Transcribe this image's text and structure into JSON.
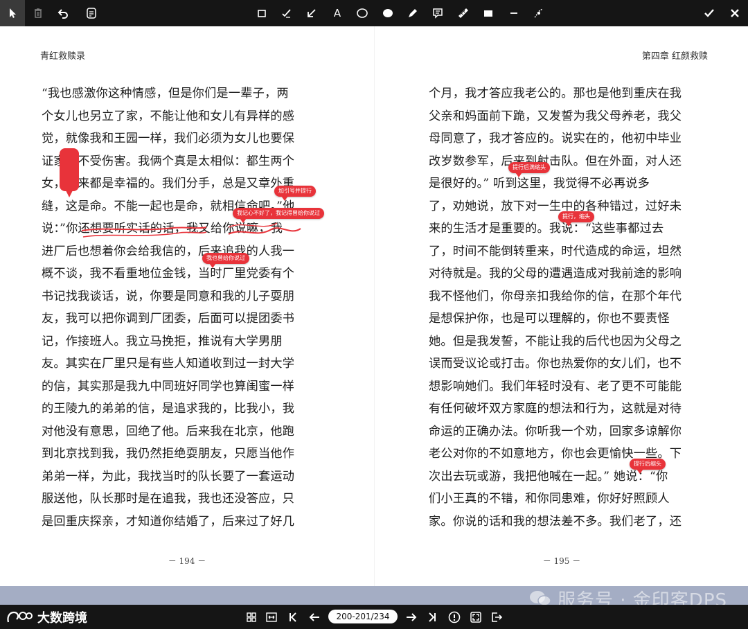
{
  "toolbar": {
    "left_tools": [
      "select-icon",
      "trash-icon",
      "undo-icon",
      "notes-icon"
    ],
    "center_tools": [
      "rectangle-icon",
      "check-pen-icon",
      "arrow-icon",
      "text-icon",
      "ellipse-icon",
      "filled-circle-icon",
      "pen-icon",
      "comment-icon",
      "ruler-icon",
      "filled-rectangle-icon",
      "line-icon",
      "node-path-icon"
    ],
    "text_tool_label": "A",
    "right_tools": [
      "confirm-icon",
      "close-icon"
    ]
  },
  "left_page": {
    "running_head": "青红救赎录",
    "lines": [
      "“我也感激你这种情感，但是你们是一辈子，两",
      "个女儿也另立了家，不能让他和女儿有异样的感",
      "觉，就像我和王园一样，我们必须为女儿也要保",
      "证家庭不受伤害。我俩个真是太相似：都生两个",
      "女，将来都是幸福的。我们分手，总是又章外重",
      "缝，这是命。不能一起也是命，就相信命吧。”他",
      "说：”你还想要听实话的话，我又给你说嘛，我",
      "进厂后也想着你会给我信的，后来追我的人我一",
      "概不谈，我不看重地位金钱，当时厂里党委有个",
      "书记找我谈话，说，你要是同意和我的儿子耍朋",
      "友，我可以把你调到厂团委，后面可以提团委书",
      "记，作接班人。我立马挽拒，推说有大学男朋",
      "友。其实在厂里只是有些人知道收到过一封大学",
      "的信，其实那是我九中同班好同学也算闺蜜一样",
      "的王陵九的弟弟的信，是追求我的，比我小，我",
      "对他没有意思，回绝了他。后来我在北京，他跑",
      "到北京找到我，我仍然拒绝耍朋友，只愿当他作",
      "弟弟一样，为此，我找当时的队长要了一套运动",
      "服送他，队长那时是在追我，我也还没答应，只",
      "是回重庆探亲，才知道你结婚了，后来过了好几"
    ],
    "page_number": "－ 194 －"
  },
  "right_page": {
    "running_head": "第四章  红颜救赎",
    "lines": [
      "个月，我才答应我老公的。那也是他到重庆在我",
      "父亲和妈面前下跪，又发誓为我父母养老，我父",
      "母同意了，我才答应的。说实在的，他初中毕业",
      "改岁数参军，后来到射击队。但在外面，对人还",
      "是很好的。” 听到这里，我觉得不必再说多",
      "了，劝她说，放下对一生中的各种错过，过好未",
      "来的生活才是重要的。我说：“这些事都过去",
      "了，时间不能倒转重来，时代造成的命运，坦然",
      "对待就是。我的父母的遭遇造成对我前途的影响",
      "我不怪他们，你母亲扣我给你的信，在那个年代",
      "是想保护你，也是可以理解的，你也不要责怪",
      "她。但是我发誓，不能让我的后代也因为父母之",
      "误而受议论或打击。你也热爱你的女儿们，也不",
      "想影响她们。我们年轻时没有、老了更不可能能",
      "有任何破坏双方家庭的想法和行为，这就是对待",
      "命运的正确办法。你听我一个劝，回家多谅解你",
      "老公对你的不如意地方，你也会更愉快一些。下",
      "次出去玩或游，我把他喊在一起。” 她说：“你",
      "们小王真的不错，和你同患难，你好好照顾人",
      "家。你说的话和我的想法差不多。我们老了，还"
    ],
    "page_number": "－ 195 －"
  },
  "annotations": {
    "vertical_note": "",
    "note_1": "加引号并提行",
    "note_2": "我记心不好了，我记得曾给你说过",
    "note_3": "我也曾给你说过",
    "note_4": "提行后满缩头",
    "note_5": "提行，缩头",
    "note_6": "提行后缩头",
    "accent_color": "#e8333a"
  },
  "watermark": {
    "text": "服务号 · 金印客DPS",
    "icon": "wechat-icon"
  },
  "logo": {
    "text": "大数跨境",
    "icon": "logo-mark-icon"
  },
  "bottombar": {
    "left_tools": [
      "grid-icon",
      "fit-width-icon",
      "first-page-icon",
      "prev-page-icon"
    ],
    "page_indicator": "200-201/234",
    "right_tools": [
      "next-page-icon",
      "last-page-icon",
      "info-icon",
      "fullscreen-icon",
      "exit-icon"
    ]
  }
}
